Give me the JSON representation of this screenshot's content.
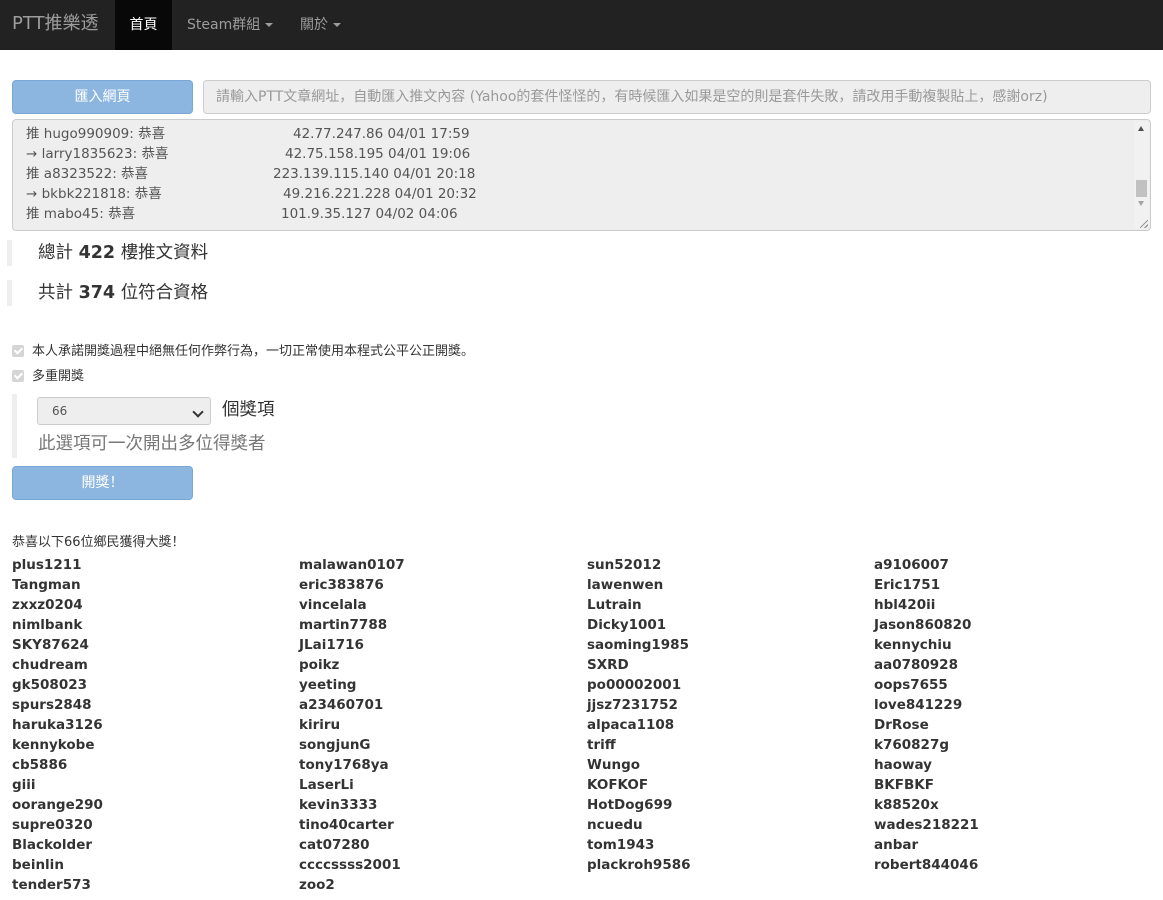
{
  "nav": {
    "brand": "PTT推樂透",
    "items": [
      {
        "label": "首頁",
        "active": true,
        "dropdown": false
      },
      {
        "label": "Steam群組",
        "active": false,
        "dropdown": true
      },
      {
        "label": "關於",
        "active": false,
        "dropdown": true
      }
    ]
  },
  "import": {
    "button_label": "匯入網頁",
    "placeholder": "請輸入PTT文章網址，自動匯入推文內容 (Yahoo的套件怪怪的，有時候匯入如果是空的則是套件失敗，請改用手動複製貼上，感謝orz)"
  },
  "pushes": [
    {
      "type": "推",
      "user": "hugo990909",
      "text": "恭喜",
      "ip_time": "42.77.247.86 04/01 17:59"
    },
    {
      "type": "→",
      "user": "larry1835623",
      "text": "恭喜",
      "ip_time": "42.75.158.195 04/01 19:06"
    },
    {
      "type": "推",
      "user": "a8323522",
      "text": "恭喜",
      "ip_time": "223.139.115.140 04/01 20:18"
    },
    {
      "type": "→",
      "user": "bkbk221818",
      "text": "恭喜",
      "ip_time": "49.216.221.228 04/01 20:32"
    },
    {
      "type": "推",
      "user": "mabo45",
      "text": "恭喜",
      "ip_time": "101.9.35.127 04/02 04:06"
    }
  ],
  "stats": {
    "total_prefix": "總計",
    "total_count": "422",
    "total_suffix": "樓推文資料",
    "qualified_prefix": "共計",
    "qualified_count": "374",
    "qualified_suffix": "位符合資格"
  },
  "options": {
    "pledge_label": "本人承諾開獎過程中絕無任何作弊行為，一切正常使用本程式公平公正開獎。",
    "pledge_checked": true,
    "multi_label": "多重開獎",
    "multi_checked": true,
    "prize_count": "66",
    "prize_unit": "個獎項",
    "multi_help": "此選項可一次開出多位得獎者"
  },
  "draw_button_label": "開獎！",
  "results": {
    "congrats": "恭喜以下66位鄉民獲得大獎！",
    "winners": [
      [
        "plus1211",
        "malawan0107",
        "sun52012",
        "a9106007"
      ],
      [
        "Tangman",
        "eric383876",
        "lawenwen",
        "Eric1751"
      ],
      [
        "zxxz0204",
        "vincelala",
        "Lutrain",
        "hbl420ii"
      ],
      [
        "nimlbank",
        "martin7788",
        "Dicky1001",
        "Jason860820"
      ],
      [
        "SKY87624",
        "JLai1716",
        "saoming1985",
        "kennychiu"
      ],
      [
        "chudream",
        "poikz",
        "SXRD",
        "aa0780928"
      ],
      [
        "gk508023",
        "yeeting",
        "po00002001",
        "oops7655"
      ],
      [
        "spurs2848",
        "a23460701",
        "jjsz7231752",
        "love841229"
      ],
      [
        "haruka3126",
        "kiriru",
        "alpaca1108",
        "DrRose"
      ],
      [
        "kennykobe",
        "songjunG",
        "triff",
        "k760827g"
      ],
      [
        "cb5886",
        "tony1768ya",
        "Wungo",
        "haoway"
      ],
      [
        "giii",
        "LaserLi",
        "KOFKOF",
        "BKFBKF"
      ],
      [
        "oorange290",
        "kevin3333",
        "HotDog699",
        "k88520x"
      ],
      [
        "supre0320",
        "tino40carter",
        "ncuedu",
        "wades218221"
      ],
      [
        "Blackolder",
        "cat07280",
        "tom1943",
        "anbar"
      ],
      [
        "beinlin",
        "ccccssss2001",
        "plackroh9586",
        "robert844046"
      ],
      [
        "tender573",
        "zoo2"
      ]
    ]
  },
  "colors": {
    "navbar_bg": "#222222",
    "primary_button": "#8cb6e0",
    "input_bg": "#eeeeee"
  }
}
